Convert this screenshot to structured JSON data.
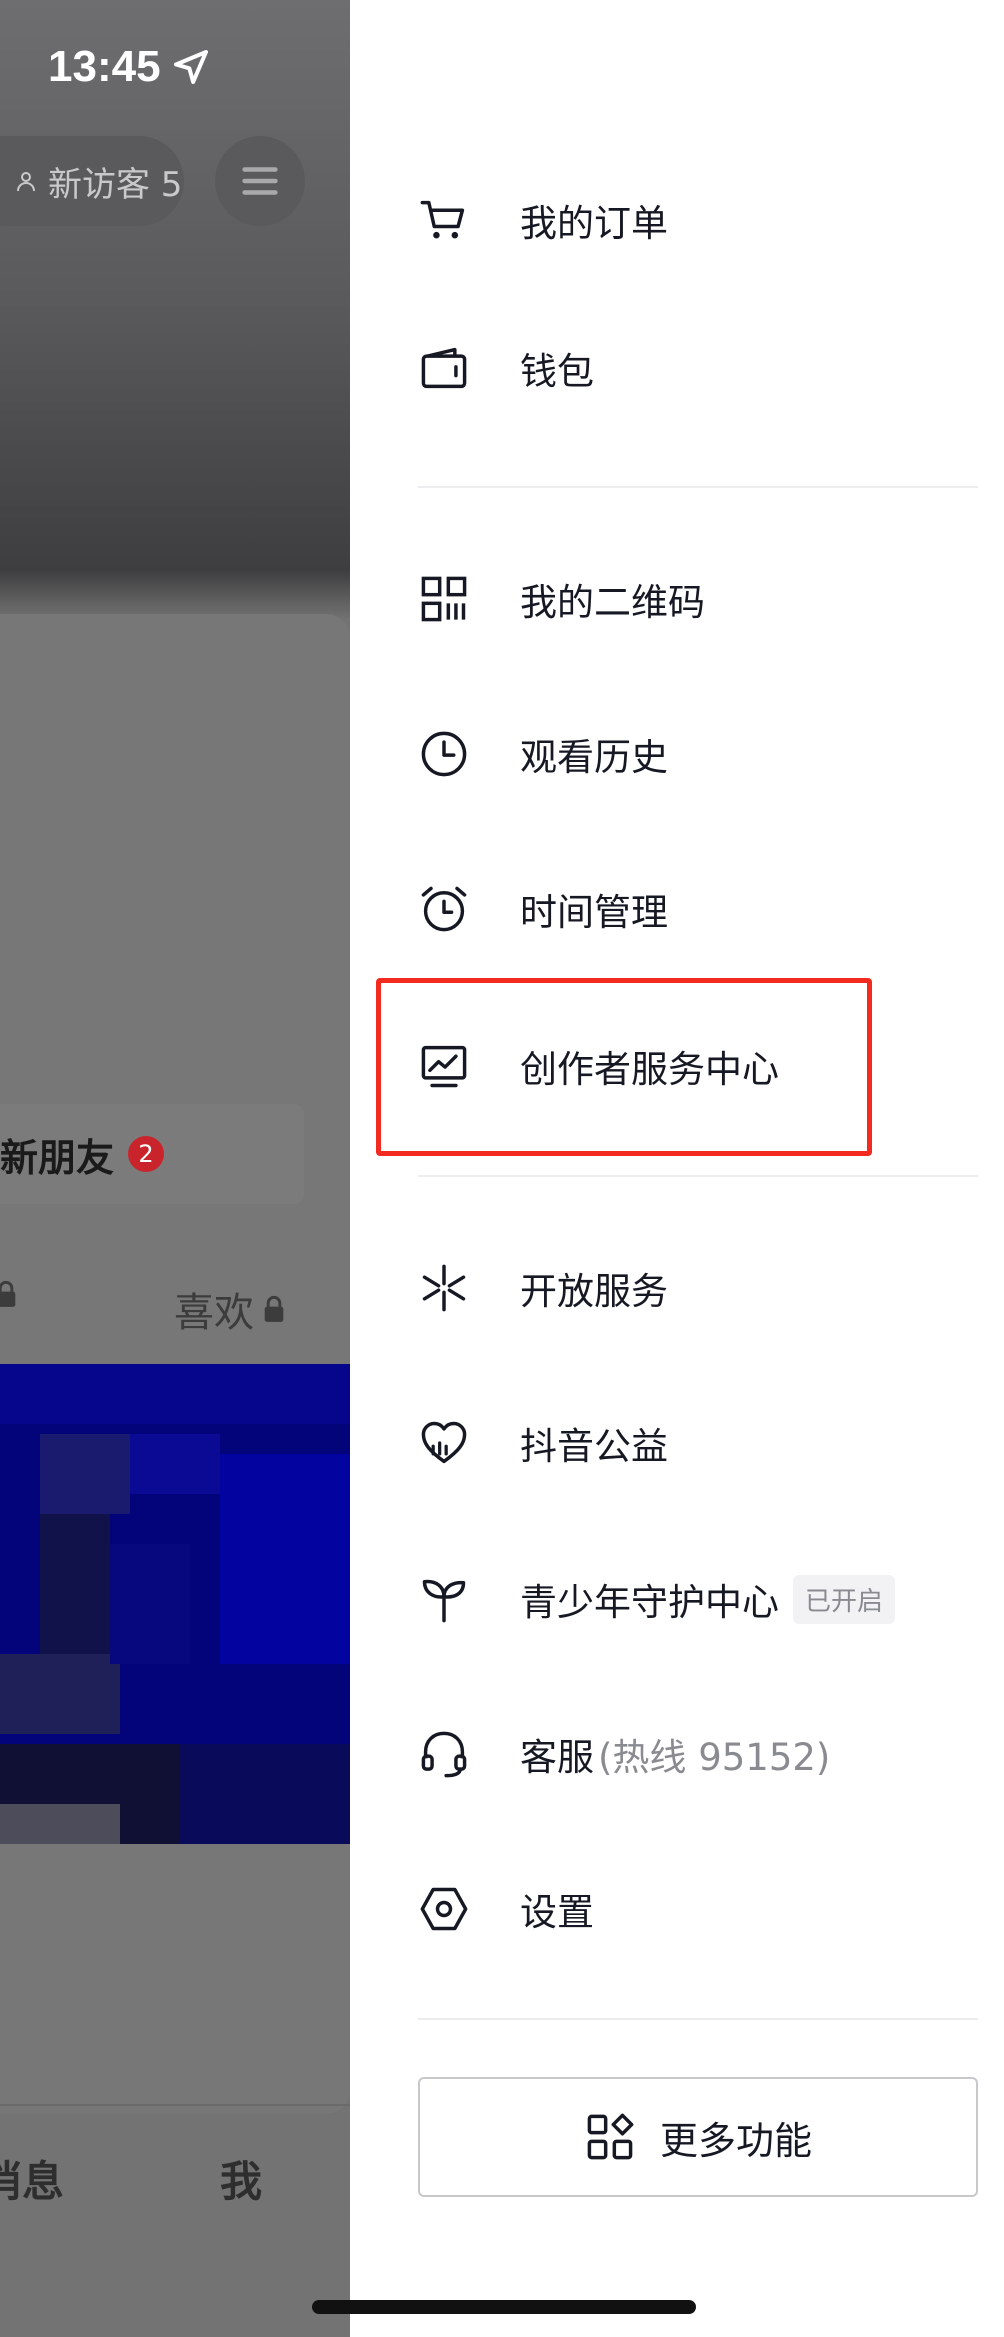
{
  "status_bar": {
    "time": "13:45"
  },
  "background": {
    "visitors_label": "新访客 5",
    "new_friends_label": "新朋友",
    "new_friends_badge": "2",
    "tab_likes": "喜欢",
    "nav_messages": "消息",
    "nav_me": "我"
  },
  "drawer": {
    "items": [
      {
        "label": "我的订单",
        "icon": "cart-icon"
      },
      {
        "label": "钱包",
        "icon": "wallet-icon"
      },
      {
        "label": "我的二维码",
        "icon": "qr-code-icon"
      },
      {
        "label": "观看历史",
        "icon": "clock-icon"
      },
      {
        "label": "时间管理",
        "icon": "alarm-clock-icon"
      },
      {
        "label": "创作者服务中心",
        "icon": "creator-chart-icon"
      },
      {
        "label": "开放服务",
        "icon": "open-service-icon"
      },
      {
        "label": "抖音公益",
        "icon": "charity-heart-icon"
      },
      {
        "label": "青少年守护中心",
        "icon": "sprout-icon",
        "tag": "已开启"
      },
      {
        "label": "客服",
        "sub": "(热线 95152)",
        "icon": "headset-icon"
      },
      {
        "label": "设置",
        "icon": "settings-hexagon-icon"
      }
    ],
    "more_button": "更多功能"
  },
  "colors": {
    "highlight_border": "#f22a1f",
    "text": "#161823",
    "secondary_text": "#8a8b91",
    "badge_red": "#c9242b"
  }
}
